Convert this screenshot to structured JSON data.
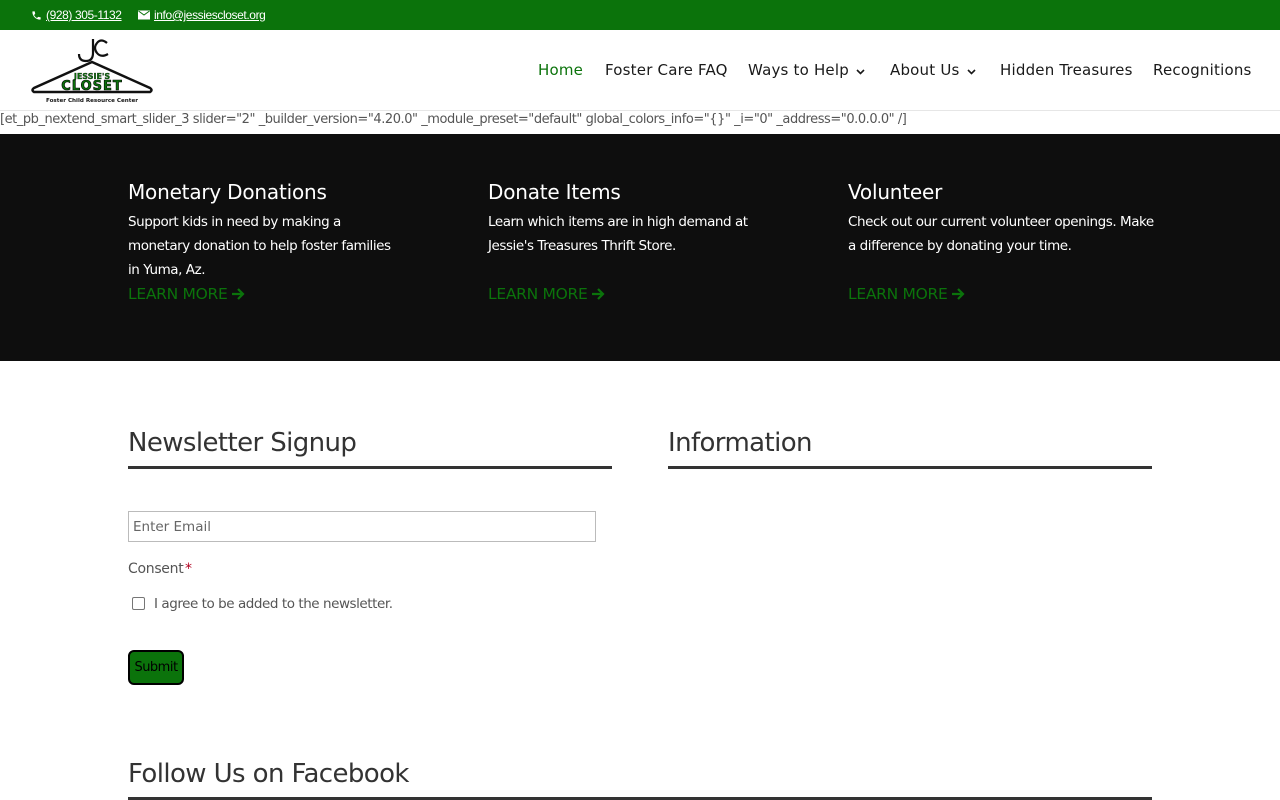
{
  "topbar": {
    "phone": "(928) 305-1132",
    "email": "info@jessiescloset.org"
  },
  "logo": {
    "monogram": "JC",
    "line1": "JESSIE'S",
    "line2": "CLOSET",
    "tagline": "Foster Child Resource Center"
  },
  "nav": {
    "items": [
      {
        "label": "Home",
        "active": true,
        "dropdown": false
      },
      {
        "label": "Foster Care FAQ",
        "active": false,
        "dropdown": false
      },
      {
        "label": "Ways to Help",
        "active": false,
        "dropdown": true
      },
      {
        "label": "About Us",
        "active": false,
        "dropdown": true
      },
      {
        "label": "Hidden Treasures",
        "active": false,
        "dropdown": false
      },
      {
        "label": "Recognitions",
        "active": false,
        "dropdown": false
      }
    ]
  },
  "shortcode": "[et_pb_nextend_smart_slider_3 slider=\"2\" _builder_version=\"4.20.0\" _module_preset=\"default\" global_colors_info=\"{}\" _i=\"0\" _address=\"0.0.0.0\" /]",
  "features": [
    {
      "title": "Monetary Donations",
      "text": "Support kids in need by making a monetary donation to help foster families in Yuma, Az.",
      "link": "LEARN MORE"
    },
    {
      "title": "Donate Items",
      "text": "Learn which items are in high demand at Jessie's Treasures Thrift Store.",
      "link": "LEARN MORE"
    },
    {
      "title": "Volunteer",
      "text": "Check out our current volunteer openings.  Make a difference by donating your time.",
      "link": "LEARN MORE"
    }
  ],
  "newsletter": {
    "title": "Newsletter Signup",
    "email_placeholder": "Enter Email",
    "consent_label": "Consent",
    "required_mark": "*",
    "checkbox_label": "I agree to be added to the newsletter.",
    "submit_label": "Submit"
  },
  "information": {
    "title": "Information"
  },
  "facebook": {
    "title": "Follow Us on Facebook"
  },
  "colors": {
    "brand_green": "#0b730b",
    "dark_band": "#0e0e0e",
    "heading": "#333333"
  }
}
